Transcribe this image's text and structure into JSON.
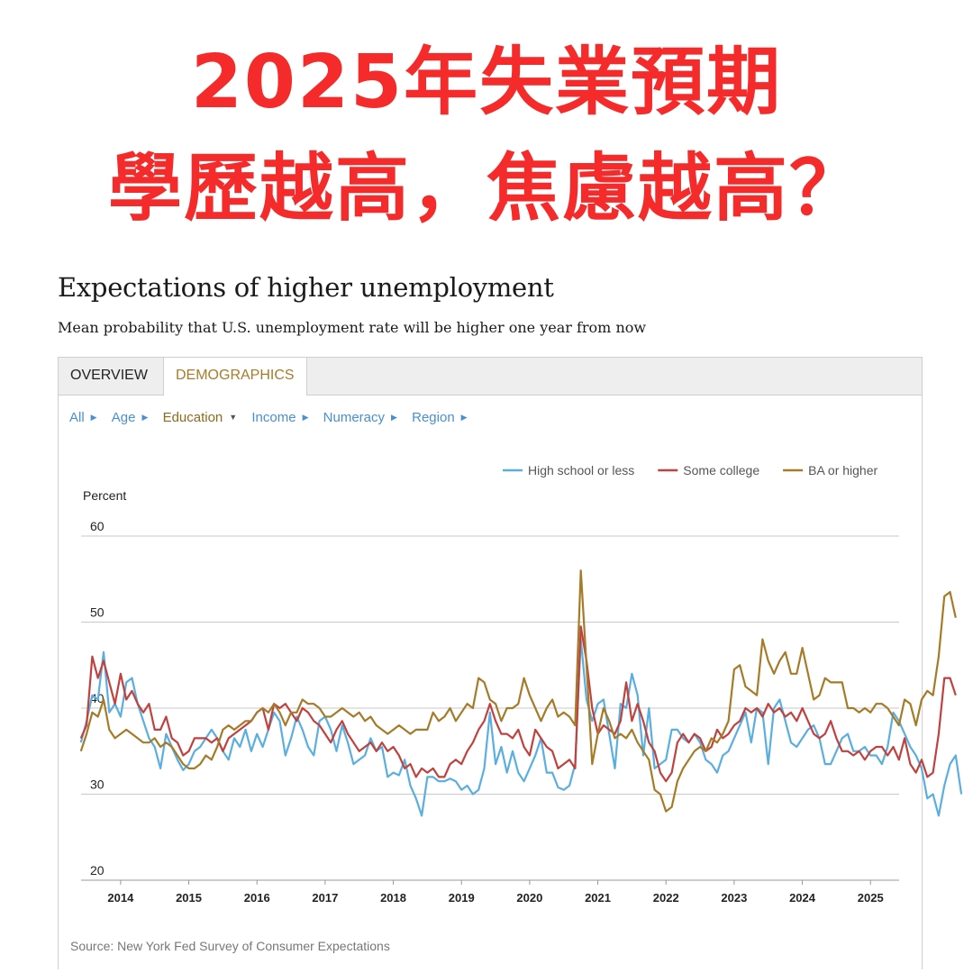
{
  "headline": {
    "line1": "2025年失業預期",
    "line2": "學歷越高，焦慮越高？"
  },
  "chart_title": "Expectations of higher unemployment",
  "chart_subtitle": "Mean probability that U.S. unemployment rate will be higher one year from now",
  "tabs": [
    {
      "label": "OVERVIEW",
      "active": false
    },
    {
      "label": "DEMOGRAPHICS",
      "active": true
    }
  ],
  "filters": [
    {
      "label": "All",
      "active": false
    },
    {
      "label": "Age",
      "active": false
    },
    {
      "label": "Education",
      "active": true
    },
    {
      "label": "Income",
      "active": false
    },
    {
      "label": "Numeracy",
      "active": false
    },
    {
      "label": "Region",
      "active": false
    }
  ],
  "source": "Source: New York Fed Survey of Consumer Expectations",
  "chart_data": {
    "type": "line",
    "ylabel": "Percent",
    "ylim": [
      20,
      60
    ],
    "yticks": [
      20,
      30,
      40,
      50,
      60
    ],
    "xlim": [
      2013.42,
      2025.42
    ],
    "xticks": [
      "2014",
      "2015",
      "2016",
      "2017",
      "2018",
      "2019",
      "2020",
      "2021",
      "2022",
      "2023",
      "2024",
      "2025"
    ],
    "legend_position": "top-right",
    "grid": "horizontal",
    "x_start": 2013.417,
    "x_step_months": 1,
    "series": [
      {
        "name": "High school or less",
        "color": "#5aaee0",
        "values": [
          36.0,
          38.5,
          41.5,
          41.0,
          46.5,
          39.5,
          40.5,
          39.0,
          43.0,
          43.5,
          40.5,
          38.5,
          36.5,
          35.5,
          33.0,
          37.0,
          35.5,
          34.0,
          32.8,
          33.5,
          35.0,
          35.5,
          36.5,
          37.5,
          36.5,
          35.0,
          34.0,
          36.5,
          35.5,
          37.5,
          35.0,
          37.0,
          35.5,
          37.5,
          39.5,
          38.5,
          34.5,
          36.5,
          39.0,
          37.5,
          35.5,
          34.5,
          38.5,
          39.0,
          37.5,
          35.0,
          38.0,
          36.0,
          33.5,
          34.0,
          34.5,
          36.5,
          35.0,
          35.5,
          32.0,
          32.5,
          32.2,
          34.0,
          31.0,
          29.5,
          27.5,
          32.0,
          32.0,
          31.5,
          31.5,
          31.8,
          31.5,
          30.5,
          31.0,
          30.0,
          30.5,
          33.0,
          39.5,
          33.5,
          35.5,
          32.5,
          35.0,
          32.5,
          31.5,
          33.0,
          34.5,
          36.5,
          32.5,
          32.5,
          30.8,
          30.5,
          31.0,
          33.5,
          48.0,
          41.0,
          38.5,
          40.5,
          41.0,
          37.0,
          33.0,
          40.5,
          40.0,
          44.0,
          41.5,
          34.5,
          40.0,
          33.0,
          33.5,
          34.0,
          37.5,
          37.5,
          36.5,
          36.0,
          37.0,
          36.0,
          34.0,
          33.5,
          32.5,
          34.5,
          35.0,
          36.5,
          38.0,
          39.5,
          36.0,
          40.0,
          39.5,
          33.5,
          40.0,
          41.0,
          38.5,
          36.0,
          35.5,
          36.5,
          37.5,
          38.0,
          36.5,
          33.5,
          33.5,
          35.0,
          36.5,
          37.0,
          35.0,
          35.0,
          35.5,
          34.5,
          34.5,
          33.5,
          35.5,
          39.5,
          38.5,
          37.0,
          35.5,
          34.5,
          33.0,
          29.5,
          30.0,
          27.5,
          31.0,
          33.5,
          34.5,
          30.0
        ]
      },
      {
        "name": "Some college",
        "color": "#c0413e",
        "values": [
          36.5,
          38.0,
          46.0,
          43.5,
          45.5,
          43.0,
          40.5,
          44.0,
          41.0,
          42.0,
          40.5,
          39.5,
          40.5,
          37.5,
          37.5,
          39.0,
          36.5,
          36.0,
          34.5,
          35.0,
          36.5,
          36.5,
          36.5,
          36.0,
          36.5,
          35.0,
          36.5,
          37.0,
          37.5,
          38.0,
          38.5,
          39.5,
          40.0,
          37.5,
          40.5,
          40.0,
          40.5,
          39.5,
          38.5,
          40.0,
          39.5,
          38.5,
          38.0,
          37.0,
          36.0,
          37.5,
          38.5,
          37.0,
          36.0,
          35.0,
          35.5,
          36.0,
          35.0,
          36.0,
          35.0,
          35.5,
          34.5,
          33.0,
          33.5,
          32.0,
          33.0,
          32.5,
          33.0,
          32.0,
          32.0,
          33.5,
          34.0,
          33.5,
          35.0,
          36.0,
          37.5,
          38.5,
          40.5,
          38.5,
          37.0,
          37.0,
          36.5,
          37.5,
          35.5,
          34.5,
          37.5,
          36.5,
          35.5,
          35.0,
          33.0,
          33.5,
          34.0,
          33.0,
          49.5,
          45.5,
          40.0,
          37.0,
          38.0,
          37.5,
          37.0,
          38.5,
          43.0,
          38.5,
          40.5,
          38.5,
          36.0,
          35.0,
          32.5,
          31.5,
          32.5,
          36.0,
          37.0,
          36.0,
          37.0,
          36.5,
          35.0,
          35.5,
          37.5,
          36.5,
          37.0,
          38.0,
          38.5,
          40.0,
          39.5,
          40.0,
          39.0,
          40.5,
          39.5,
          40.0,
          39.0,
          39.5,
          38.5,
          40.0,
          38.5,
          37.0,
          36.5,
          37.0,
          38.5,
          36.5,
          35.0,
          35.0,
          34.5,
          35.0,
          34.0,
          35.0,
          35.5,
          35.5,
          34.5,
          35.5,
          34.0,
          36.5,
          33.5,
          32.5,
          34.0,
          32.0,
          32.5,
          37.0,
          43.5,
          43.5,
          41.5
        ]
      },
      {
        "name": "BA or higher",
        "color": "#a57b28",
        "values": [
          35.0,
          37.0,
          39.5,
          39.0,
          41.0,
          37.5,
          36.5,
          37.0,
          37.5,
          37.0,
          36.5,
          36.0,
          36.0,
          36.5,
          35.5,
          36.0,
          35.5,
          34.5,
          33.5,
          33.0,
          33.0,
          33.5,
          34.5,
          34.0,
          35.5,
          37.5,
          38.0,
          37.5,
          38.0,
          38.5,
          38.5,
          39.5,
          40.0,
          39.5,
          40.5,
          39.5,
          38.0,
          39.5,
          39.5,
          41.0,
          40.5,
          40.5,
          40.0,
          39.0,
          39.0,
          39.5,
          40.0,
          39.5,
          39.0,
          39.5,
          38.5,
          39.0,
          38.0,
          37.5,
          37.0,
          37.5,
          38.0,
          37.5,
          37.0,
          37.5,
          37.5,
          37.5,
          39.5,
          38.5,
          39.0,
          40.0,
          38.5,
          39.5,
          40.5,
          40.0,
          43.5,
          43.0,
          41.0,
          40.5,
          38.5,
          40.0,
          40.0,
          40.5,
          43.5,
          41.5,
          40.0,
          38.5,
          40.0,
          41.0,
          39.0,
          39.5,
          39.0,
          38.0,
          56.0,
          45.0,
          33.5,
          37.0,
          40.0,
          38.5,
          36.5,
          37.0,
          36.5,
          37.5,
          36.0,
          35.0,
          34.0,
          30.5,
          30.0,
          28.0,
          28.5,
          31.5,
          33.0,
          34.0,
          35.0,
          35.5,
          35.0,
          36.5,
          36.0,
          37.0,
          38.5,
          44.5,
          45.0,
          42.5,
          42.0,
          41.5,
          48.0,
          45.5,
          44.0,
          45.5,
          46.5,
          44.0,
          44.0,
          47.0,
          44.0,
          41.0,
          41.5,
          43.5,
          43.0,
          43.0,
          43.0,
          40.0,
          40.0,
          39.5,
          40.0,
          39.5,
          40.5,
          40.5,
          40.0,
          39.0,
          38.0,
          41.0,
          40.5,
          38.0,
          41.0,
          42.0,
          41.5,
          46.0,
          53.0,
          53.5,
          50.5
        ]
      }
    ]
  }
}
